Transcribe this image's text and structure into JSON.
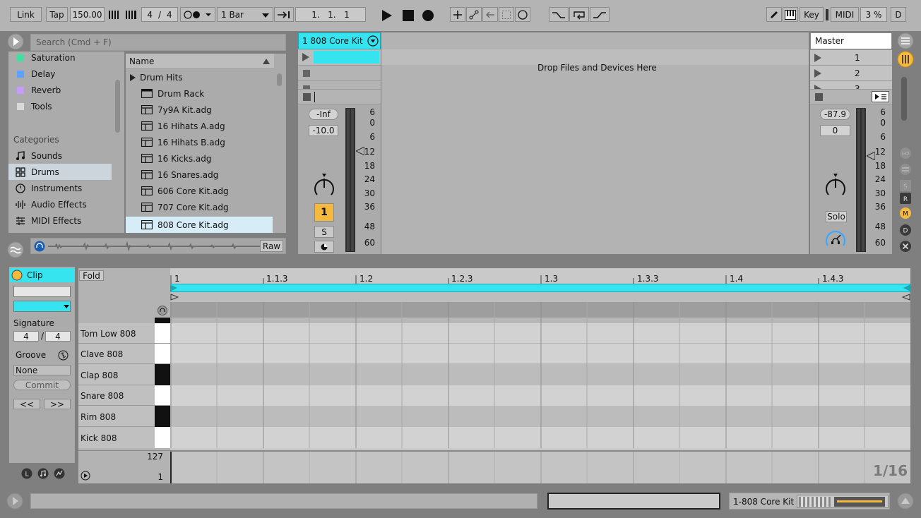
{
  "control_bar": {
    "link": "Link",
    "tap": "Tap",
    "tempo": "150.00",
    "sig_num": "4",
    "sig_slash": "/",
    "sig_den": "4",
    "quantize": "1 Bar",
    "position": "1.   1.   1",
    "key": "Key",
    "midi": "MIDI",
    "cpu": "3 %",
    "d": "D"
  },
  "browser": {
    "search_placeholder": "Search (Cmd + F)",
    "collections": [
      {
        "label": "Saturation",
        "color": "#3fe0a0"
      },
      {
        "label": "Delay",
        "color": "#5aa3ff"
      },
      {
        "label": "Reverb",
        "color": "#c79bff"
      },
      {
        "label": "Tools",
        "color": "#d9d9d9"
      }
    ],
    "categories_title": "Categories",
    "categories": [
      "Sounds",
      "Drums",
      "Instruments",
      "Audio Effects",
      "MIDI Effects"
    ],
    "column_header": "Name",
    "items": [
      "Drum Hits",
      "Drum Rack",
      "7y9A Kit.adg",
      "16 Hihats A.adg",
      "16 Hihats B.adg",
      "16 Kicks.adg",
      "16 Snares.adg",
      "606 Core Kit.adg",
      "707 Core Kit.adg",
      "808 Core Kit.adg"
    ],
    "raw": "Raw"
  },
  "session": {
    "track_name": "1 808 Core Kit",
    "drop_text": "Drop Files and Devices Here",
    "volume": "-Inf",
    "pan_value": "-10.0",
    "scale": [
      "6",
      "0",
      "6",
      "12",
      "18",
      "24",
      "30",
      "36",
      "48",
      "60"
    ],
    "track_number": "1",
    "solo": "S"
  },
  "master": {
    "name": "Master",
    "scenes": [
      "1",
      "2",
      "3"
    ],
    "volume": "-87.9",
    "pan_value": "0",
    "scale": [
      "6",
      "0",
      "6",
      "12",
      "18",
      "24",
      "30",
      "36",
      "48",
      "60"
    ],
    "solo": "Solo"
  },
  "clip": {
    "title": "Clip",
    "signature_label": "Signature",
    "sig_num": "4",
    "sig_den": "4",
    "groove_label": "Groove",
    "groove_value": "None",
    "commit": "Commit",
    "prev": "<<",
    "next": ">>"
  },
  "midi_editor": {
    "fold": "Fold",
    "ruler": [
      "1",
      "1.1.3",
      "1.2",
      "1.2.3",
      "1.3",
      "1.3.3",
      "1.4",
      "1.4.3"
    ],
    "notes": [
      "Tom Low 808",
      "Clave 808",
      "Clap 808",
      "Snare 808",
      "Rim 808",
      "Kick 808"
    ],
    "velocity_max": "127",
    "velocity_min": "1",
    "grid": "1/16"
  },
  "status": {
    "track": "1-808 Core Kit"
  },
  "colors": {
    "accent": "#36e4f0",
    "track_number": "#f5b93e",
    "solo": "#f5b93e"
  }
}
